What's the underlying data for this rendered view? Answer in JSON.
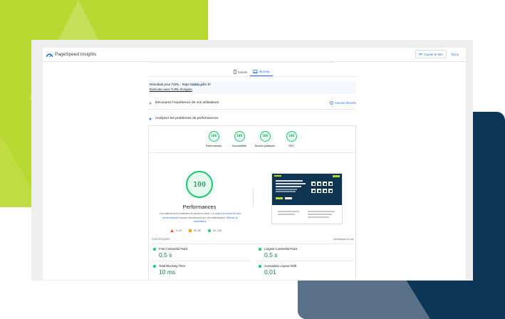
{
  "app": {
    "title": "PageSpeed Insights"
  },
  "header": {
    "copy_link_label": "Copier le lien",
    "docs_label": "Docs"
  },
  "tabs": [
    {
      "label": "Mobile",
      "active": false
    },
    {
      "label": "Bureau",
      "active": true
    }
  ],
  "results": {
    "prefix": "Résultats pour l'URL : https://",
    "highlight": "www",
    "suffix": ".gdkn.fr/",
    "origin_link": "Exécuter avec l'URL d'origine"
  },
  "crux_section": {
    "label": "Découvrez l'expérience de vos utilisateurs",
    "no_data": "Aucune donnée"
  },
  "diagnose_section": {
    "label": "Analysez les problèmes de performances"
  },
  "scores": [
    {
      "value": "100",
      "label": "Performances"
    },
    {
      "value": "100",
      "label": "Accessibilité"
    },
    {
      "value": "100",
      "label": "Bonnes pratiques"
    },
    {
      "value": "100",
      "label": "SEO"
    }
  ],
  "main_score": {
    "value": "100",
    "title": "Performances",
    "desc_1": "Les valeurs sont estimées et peuvent varier. Le ",
    "desc_link_1": "calcul du score lié aux performances",
    "desc_2": " repose directement sur ces statistiques. ",
    "desc_link_2": "Afficher le calculateur."
  },
  "legend": [
    {
      "range": "0–49",
      "color": "#ff4e42"
    },
    {
      "range": "50–89",
      "color": "#ffa400"
    },
    {
      "range": "90–100",
      "color": "#0cce6b"
    }
  ],
  "diagnostics": {
    "heading": "STATISTIQUES",
    "expand": "Développer la vue"
  },
  "metrics": [
    {
      "label": "First Contentful Paint",
      "value": "0,5 s"
    },
    {
      "label": "Largest Contentful Paint",
      "value": "0,5 s"
    },
    {
      "label": "Total Blocking Time",
      "value": "10 ms"
    },
    {
      "label": "Cumulative Layout Shift",
      "value": "0,01"
    }
  ],
  "colors": {
    "accent": "#1a73e8",
    "pass": "#0cce6b",
    "brand_green": "#b8d832",
    "brand_navy": "#0c3556"
  }
}
